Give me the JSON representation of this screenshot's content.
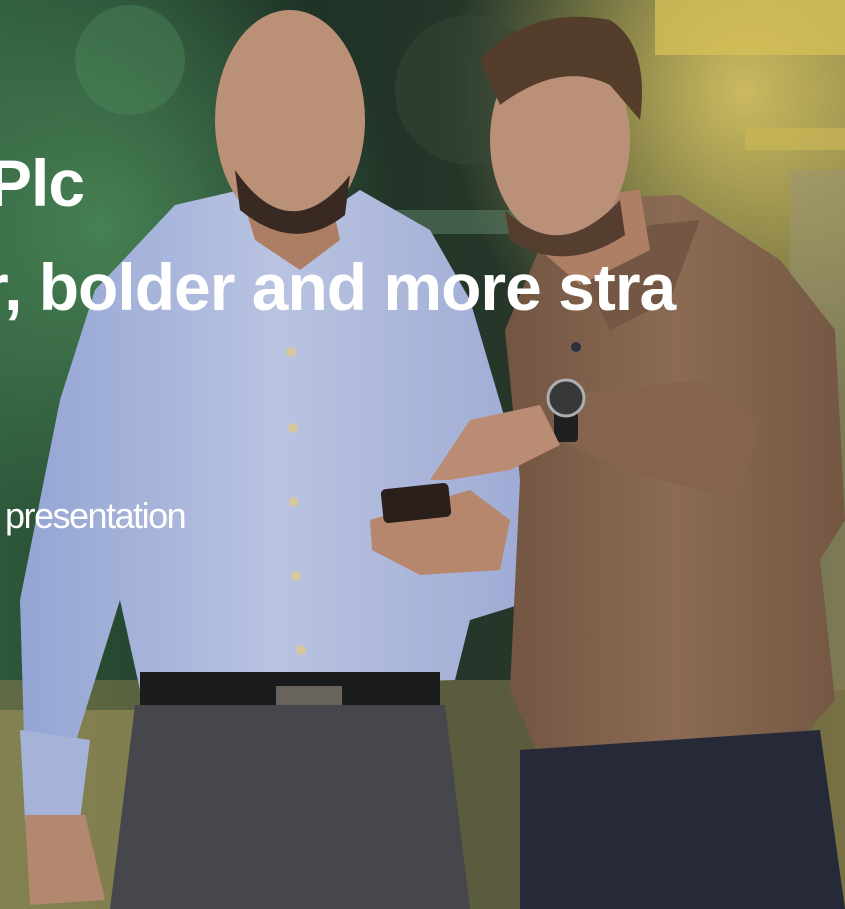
{
  "slide": {
    "title": "Plc",
    "subtitle": "ger, bolder and more stra",
    "caption": "r presentation"
  },
  "colors": {
    "text": "#ffffff",
    "background_dark": "#1d2a22",
    "background_green": "#3b6b46",
    "background_amber": "#b9962e",
    "shirt_blue": "#b7c4ea",
    "sweater_brown": "#8d6a52",
    "trousers_grey": "#4a4a4f",
    "jeans_navy": "#272a3a",
    "skin": "#c8977c"
  },
  "icons": {
    "background_image": "photo-two-men-looking-at-phone"
  }
}
